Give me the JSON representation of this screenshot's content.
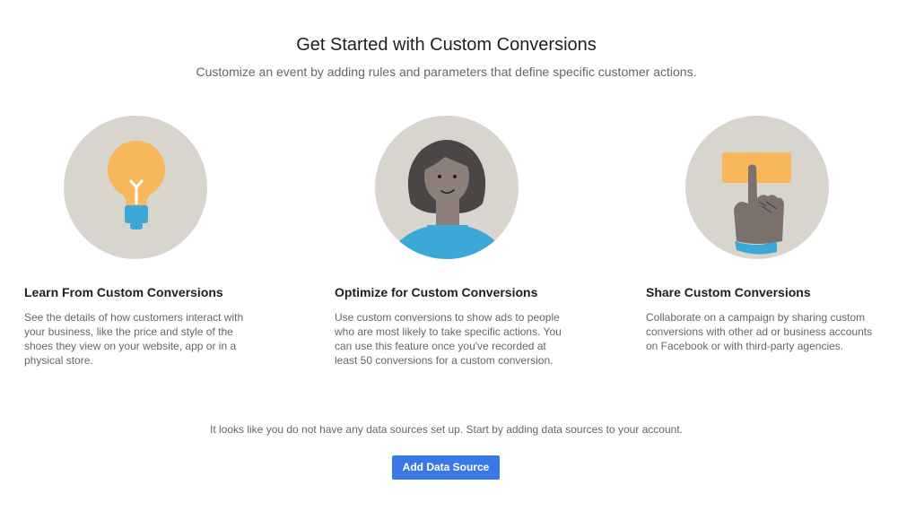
{
  "header": {
    "title": "Get Started with Custom Conversions",
    "subtitle": "Customize an event by adding rules and parameters that define specific customer actions."
  },
  "cards": [
    {
      "icon": "lightbulb-icon",
      "title": "Learn From Custom Conversions",
      "body": "See the details of how customers interact with your business, like the price and style of the shoes they view on your website, app or in a physical store."
    },
    {
      "icon": "person-icon",
      "title": "Optimize for Custom Conversions",
      "body": "Use custom conversions to show ads to people who are most likely to take specific actions. You can use this feature once you've recorded at least 50 conversions for a custom conversion."
    },
    {
      "icon": "pointing-hand-icon",
      "title": "Share Custom Conversions",
      "body": "Collaborate on a campaign by sharing custom conversions with other ad or business accounts on Facebook or with third-party agencies."
    }
  ],
  "footer": {
    "notice": "It looks like you do not have any data sources set up. Start by adding data sources to your account.",
    "button_label": "Add Data Source"
  },
  "colors": {
    "circle_bg": "#d8d5cf",
    "accent_orange": "#f7b75a",
    "accent_blue": "#3ba8d8",
    "button_blue": "#3b78e7"
  }
}
